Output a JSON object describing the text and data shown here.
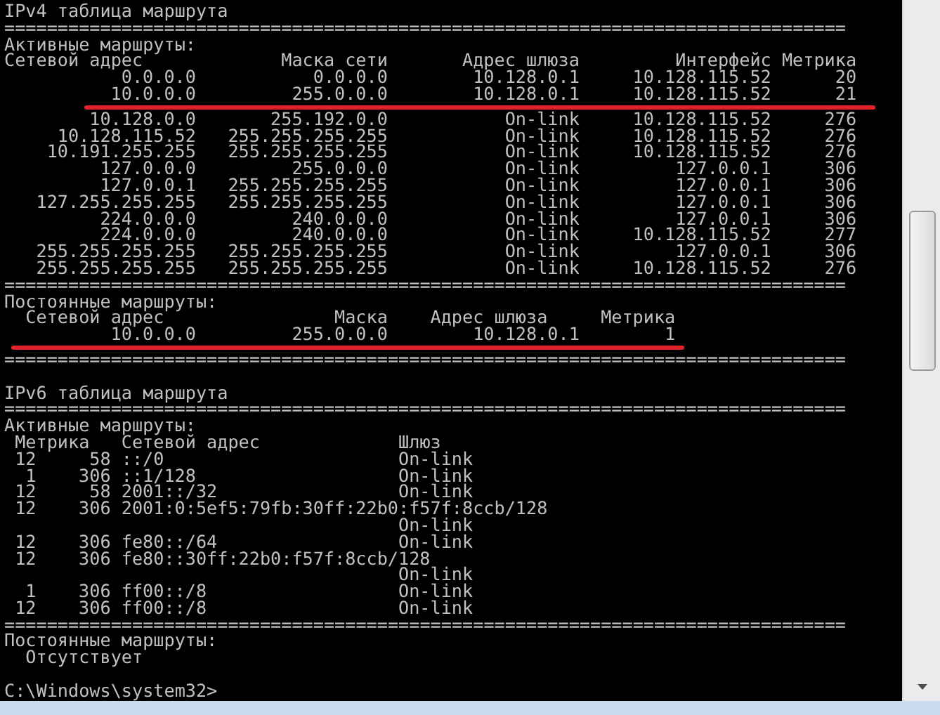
{
  "ipv4": {
    "title": "IPv4 таблица маршрута",
    "rule_top": "===============================================================================",
    "active": {
      "title": "Активные маршруты:",
      "columns": [
        "Сетевой адрес",
        "Маска сети",
        "Адрес шлюза",
        "Интерфейс",
        "Метрика"
      ],
      "rows": [
        {
          "cells": [
            "0.0.0.0",
            "0.0.0.0",
            "10.128.0.1",
            "10.128.115.52",
            "20"
          ],
          "underlined": false
        },
        {
          "cells": [
            "10.0.0.0",
            "255.0.0.0",
            "10.128.0.1",
            "10.128.115.52",
            "21"
          ],
          "underlined": true
        },
        {
          "cells": [
            "10.128.0.0",
            "255.192.0.0",
            "On-link",
            "10.128.115.52",
            "276"
          ],
          "underlined": false
        },
        {
          "cells": [
            "10.128.115.52",
            "255.255.255.255",
            "On-link",
            "10.128.115.52",
            "276"
          ],
          "underlined": false
        },
        {
          "cells": [
            "10.191.255.255",
            "255.255.255.255",
            "On-link",
            "10.128.115.52",
            "276"
          ],
          "underlined": false
        },
        {
          "cells": [
            "127.0.0.0",
            "255.0.0.0",
            "On-link",
            "127.0.0.1",
            "306"
          ],
          "underlined": false
        },
        {
          "cells": [
            "127.0.0.1",
            "255.255.255.255",
            "On-link",
            "127.0.0.1",
            "306"
          ],
          "underlined": false
        },
        {
          "cells": [
            "127.255.255.255",
            "255.255.255.255",
            "On-link",
            "127.0.0.1",
            "306"
          ],
          "underlined": false
        },
        {
          "cells": [
            "224.0.0.0",
            "240.0.0.0",
            "On-link",
            "127.0.0.1",
            "306"
          ],
          "underlined": false
        },
        {
          "cells": [
            "224.0.0.0",
            "240.0.0.0",
            "On-link",
            "10.128.115.52",
            "277"
          ],
          "underlined": false
        },
        {
          "cells": [
            "255.255.255.255",
            "255.255.255.255",
            "On-link",
            "127.0.0.1",
            "306"
          ],
          "underlined": false
        },
        {
          "cells": [
            "255.255.255.255",
            "255.255.255.255",
            "On-link",
            "10.128.115.52",
            "276"
          ],
          "underlined": false
        }
      ],
      "rule_end": "==============================================================================="
    },
    "persistent": {
      "title": "Постоянные маршруты:",
      "columns": [
        "Сетевой адрес",
        "Маска",
        "Адрес шлюза",
        "Метрика"
      ],
      "rows": [
        {
          "cells": [
            "10.0.0.0",
            "255.0.0.0",
            "10.128.0.1",
            "1"
          ],
          "underlined": true
        }
      ],
      "rule_end": "==============================================================================="
    }
  },
  "ipv6": {
    "title": "IPv6 таблица маршрута",
    "rule_top": "===============================================================================",
    "active": {
      "title": "Активные маршруты:",
      "header": {
        "metric": "Метрика",
        "destination": "Сетевой адрес",
        "gateway": "Шлюз"
      },
      "routes": [
        {
          "kind": "single",
          "index": "12",
          "metric": "58",
          "destination": "::/0",
          "gateway": "On-link"
        },
        {
          "kind": "single",
          "index": "1",
          "metric": "306",
          "destination": "::1/128",
          "gateway": "On-link"
        },
        {
          "kind": "single",
          "index": "12",
          "metric": "58",
          "destination": "2001::/32",
          "gateway": "On-link"
        },
        {
          "kind": "wrapped",
          "index": "12",
          "metric": "306",
          "destination": "2001:0:5ef5:79fb:30ff:22b0:f57f:8ccb/128",
          "gateway": "On-link"
        },
        {
          "kind": "single",
          "index": "12",
          "metric": "306",
          "destination": "fe80::/64",
          "gateway": "On-link"
        },
        {
          "kind": "wrapped",
          "index": "12",
          "metric": "306",
          "destination": "fe80::30ff:22b0:f57f:8ccb/128",
          "gateway": "On-link"
        },
        {
          "kind": "single",
          "index": "1",
          "metric": "306",
          "destination": "ff00::/8",
          "gateway": "On-link"
        },
        {
          "kind": "single",
          "index": "12",
          "metric": "306",
          "destination": "ff00::/8",
          "gateway": "On-link"
        }
      ],
      "rule_end": "==============================================================================="
    },
    "persistent": {
      "title": "Постоянные маршруты:",
      "none": "Отсутствует"
    }
  },
  "prompt": "C:\\Windows\\system32>"
}
